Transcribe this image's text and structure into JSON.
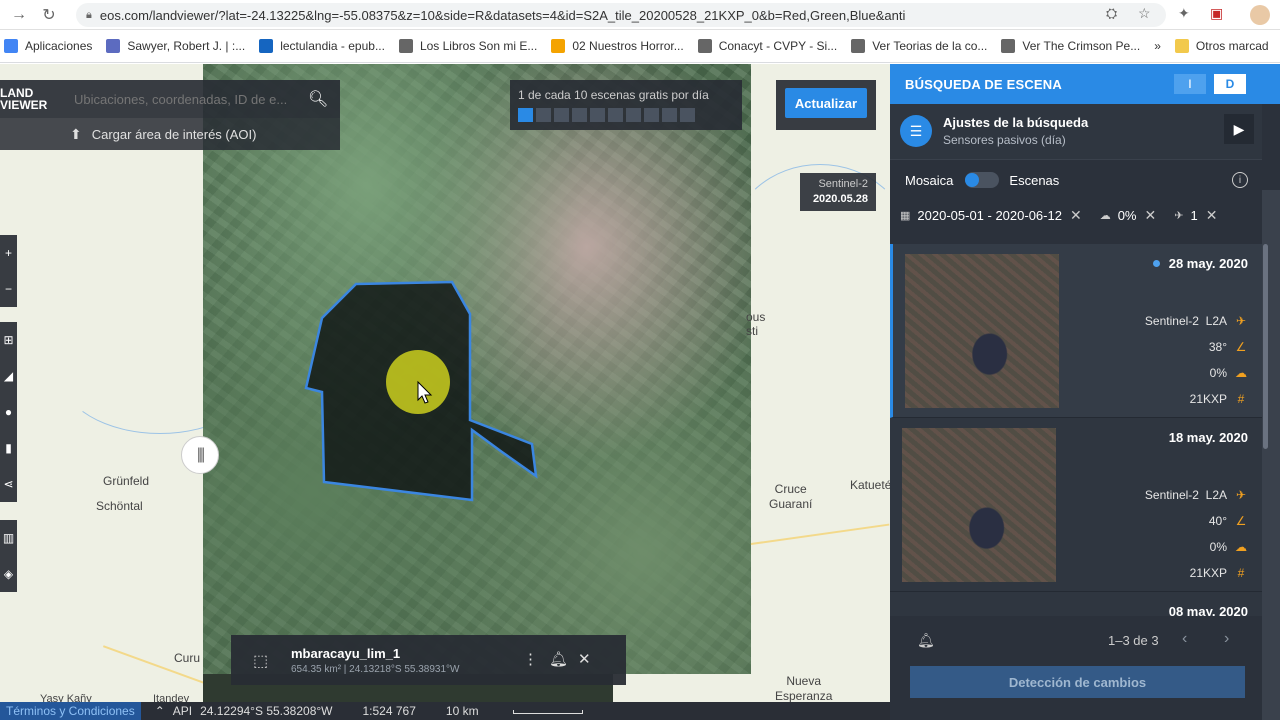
{
  "browser": {
    "url": "eos.com/landviewer/?lat=-24.13225&lng=-55.08375&z=10&side=R&datasets=4&id=S2A_tile_20200528_21KXP_0&b=Red,Green,Blue&anti",
    "bookmarks": [
      {
        "label": "Aplicaciones",
        "icon": "apps-icon",
        "color": "#4285f4"
      },
      {
        "label": "Sawyer, Robert J. | :...",
        "icon": "site-icon",
        "color": "#5c6bc0"
      },
      {
        "label": "lectulandia - epub...",
        "icon": "site-icon",
        "color": "#1565c0"
      },
      {
        "label": "Los Libros Son mi E...",
        "icon": "globe-icon",
        "color": "#666666"
      },
      {
        "label": "02 Nuestros Horror...",
        "icon": "info-icon",
        "color": "#f4a300"
      },
      {
        "label": "Conacyt - CVPY - Si...",
        "icon": "globe-icon",
        "color": "#666666"
      },
      {
        "label": "Ver Teorias de la co...",
        "icon": "globe-icon",
        "color": "#666666"
      },
      {
        "label": "Ver The Crimson Pe...",
        "icon": "globe-icon",
        "color": "#666666"
      }
    ],
    "more": "»",
    "other_bookmarks": "Otros marcad"
  },
  "map": {
    "search_placeholder": "Ubicaciones, coordenadas, ID de e...",
    "logo": "LAND VIEWER",
    "aoi_upload": "Cargar área de interés (AOI)",
    "quota_text": "1 de cada 10 escenas gratis por día",
    "quota_used": 1,
    "quota_total": 10,
    "update_button": "Actualizar",
    "badge_sensor": "Sentinel-2",
    "badge_date": "2020.05.28",
    "places": {
      "grunfeld": "Grünfeld",
      "schontal": "Schöntal",
      "cruce_guarani": "Cruce\nGuaraní",
      "katuete": "Katueté",
      "nueva_esperanza": "Nueva\nEsperanza",
      "curu": "Curu",
      "yasy": "Yasy Kañy",
      "itandey": "Itandey",
      "tous": "ous\nsti"
    },
    "aoi_card": {
      "name": "mbaracayu_lim_1",
      "meta": "654.35 km² | 24.13218°S 55.38931°W"
    },
    "status": {
      "terms": "Términos y Condiciones",
      "api": "API",
      "coords": "24.12294°S 55.38208°W",
      "scale": "1:524 767",
      "distance": "10 km"
    }
  },
  "panel": {
    "title": "BÚSQUEDA DE ESCENA",
    "seg_left": "I",
    "seg_right": "D",
    "settings_title": "Ajustes de la búsqueda",
    "settings_sub": "Sensores pasivos (día)",
    "mosaic": "Mosaica",
    "scenes_label": "Escenas",
    "filter_dates": "2020-05-01 - 2020-06-12",
    "filter_cloud": "0%",
    "filter_sat": "1",
    "scenes": [
      {
        "date": "28 may. 2020",
        "sensor": "Sentinel-2",
        "level": "L2A",
        "angle": "38°",
        "cloud": "0%",
        "tile": "21KXP"
      },
      {
        "date": "18 may. 2020",
        "sensor": "Sentinel-2",
        "level": "L2A",
        "angle": "40°",
        "cloud": "0%",
        "tile": "21KXP"
      },
      {
        "date": "08 may. 2020"
      }
    ],
    "pager": "1–3 de 3",
    "change_detection": "Detección de cambios"
  },
  "colors": {
    "accent": "#2a8ae5",
    "panel_bg": "#2b313b",
    "aoi_outline": "#3b86e0",
    "marker": "#e3e61e"
  }
}
